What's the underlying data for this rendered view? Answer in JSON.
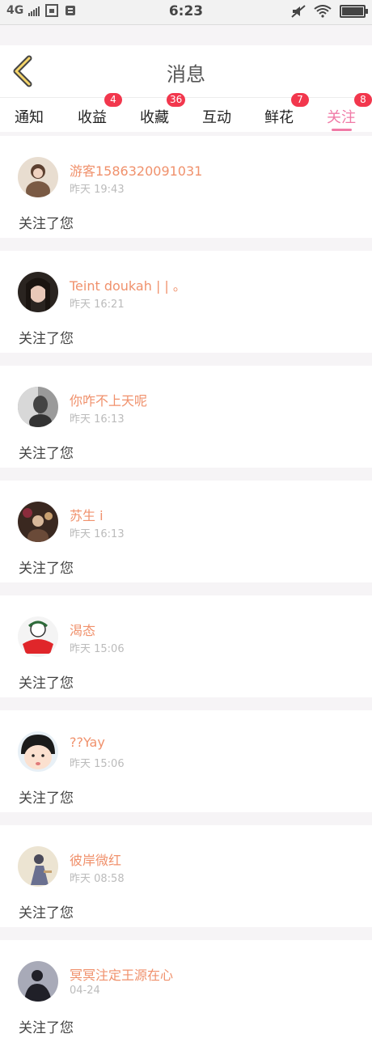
{
  "status_bar": {
    "network": "4G",
    "time": "6:23"
  },
  "header": {
    "title": "消息",
    "back_icon": "chevron-left-icon"
  },
  "tabs": [
    {
      "label": "通知",
      "badge": ""
    },
    {
      "label": "收益",
      "badge": "4"
    },
    {
      "label": "收藏",
      "badge": "36"
    },
    {
      "label": "互动",
      "badge": ""
    },
    {
      "label": "鲜花",
      "badge": "7"
    },
    {
      "label": "关注",
      "badge": "8",
      "active": true
    }
  ],
  "colors": {
    "accent": "#f07aa6",
    "username": "#f0916c",
    "badge": "#f2374d"
  },
  "feed": [
    {
      "username": "游客1586320091031",
      "time": "昨天 19:43",
      "action": "关注了您",
      "avatar": "avatar-girl-icon"
    },
    {
      "username": "Teint doukah | | 。",
      "time": "昨天 16:21",
      "action": "关注了您",
      "avatar": "avatar-woman-icon"
    },
    {
      "username": "你咋不上天呢",
      "time": "昨天 16:13",
      "action": "关注了您",
      "avatar": "avatar-gray-icon"
    },
    {
      "username": "苏生 i",
      "time": "昨天 16:13",
      "action": "关注了您",
      "avatar": "avatar-dark-icon"
    },
    {
      "username": "渴态",
      "time": "昨天 15:06",
      "action": "关注了您",
      "avatar": "avatar-cartoon-red-icon"
    },
    {
      "username": "??Yay",
      "time": "昨天 15:06",
      "action": "关注了您",
      "avatar": "avatar-cartoon-face-icon"
    },
    {
      "username": "彼岸微红",
      "time": "昨天 08:58",
      "action": "关注了您",
      "avatar": "avatar-person-icon"
    },
    {
      "username": "冥冥注定王源在心",
      "time": "04-24",
      "action": "关注了您",
      "avatar": "avatar-silhouette-icon"
    }
  ]
}
